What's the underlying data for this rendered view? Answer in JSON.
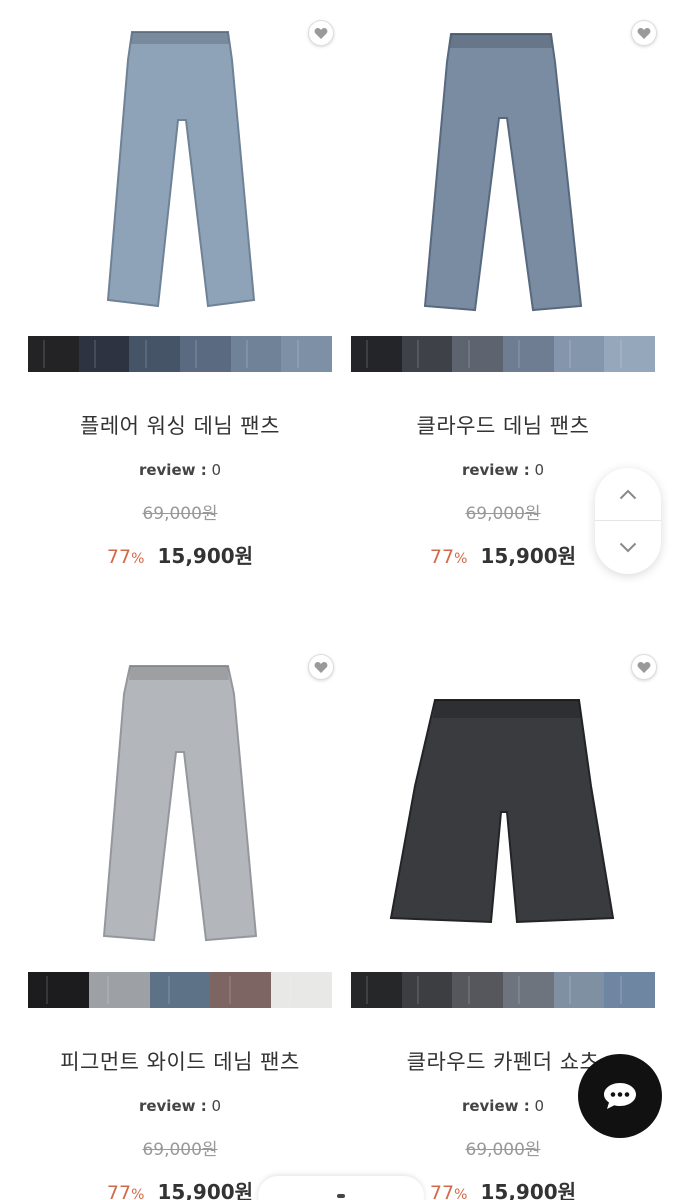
{
  "products": [
    {
      "name": "플레어 워싱 데님 팬츠",
      "review_label": "review :",
      "review_count": "0",
      "original_price": "69,000원",
      "discount_pct": "77",
      "discount_sign": "%",
      "sale_price": "15,900원",
      "garment_color": "#8fa3b8",
      "garment_shade": "#6f8296",
      "swatches": [
        "#232326",
        "#2d3340",
        "#465468",
        "#5a6a80",
        "#6f8298",
        "#7d90a6"
      ]
    },
    {
      "name": "클라우드 데님 팬츠",
      "review_label": "review :",
      "review_count": "0",
      "original_price": "69,000원",
      "discount_pct": "77",
      "discount_sign": "%",
      "sale_price": "15,900원",
      "garment_color": "#7a8ca2",
      "garment_shade": "#58697f",
      "swatches": [
        "#242528",
        "#3e4148",
        "#5d6470",
        "#6e7d92",
        "#8496ac",
        "#95a7bb"
      ]
    },
    {
      "name": "피그먼트 와이드 데님 팬츠",
      "review_label": "review :",
      "review_count": "0",
      "original_price": "69,000원",
      "discount_pct": "77",
      "discount_sign": "%",
      "sale_price": "15,900원",
      "garment_color": "#b3b6ba",
      "garment_shade": "#94989d",
      "swatches": [
        "#1c1c1e",
        "#9da1a6",
        "#5d7287",
        "#7d6563",
        "#e8e8e6"
      ]
    },
    {
      "name": "클라우드 카펜더 쇼츠",
      "review_label": "review :",
      "review_count": "0",
      "original_price": "69,000원",
      "discount_pct": "77",
      "discount_sign": "%",
      "sale_price": "15,900원",
      "garment_color": "#3a3b3e",
      "garment_shade": "#232427",
      "swatches": [
        "#262729",
        "#3d3e42",
        "#55575c",
        "#6d747e",
        "#8090a3",
        "#6f86a3"
      ]
    }
  ],
  "icons": {
    "wishlist": "heart-icon",
    "scroll_up": "chevron-up-icon",
    "scroll_down": "chevron-down-icon",
    "chat": "chat-bubble-icon"
  },
  "colors": {
    "discount": "#d26a4a",
    "chat_button": "#111111"
  }
}
